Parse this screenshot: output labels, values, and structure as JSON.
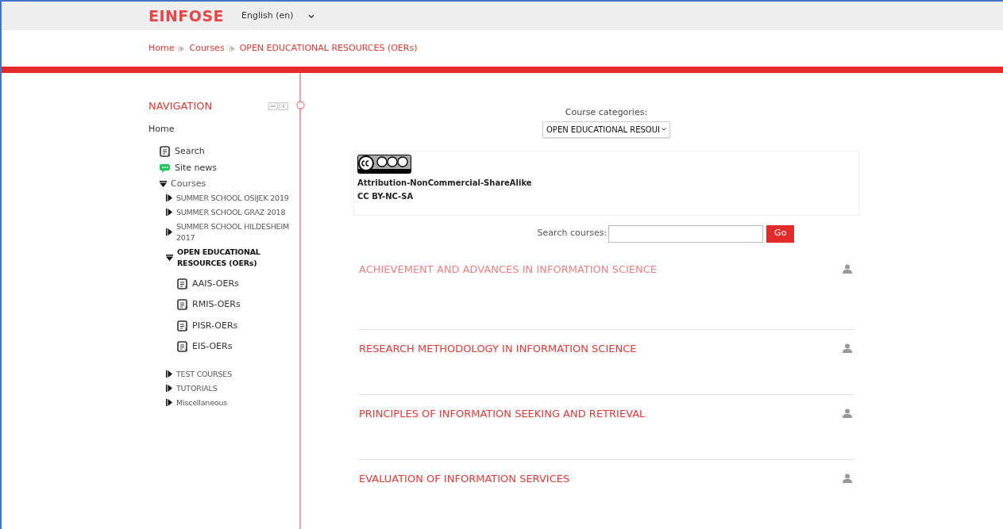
{
  "header": {
    "logo": "EINFOSE",
    "language": "English (en)"
  },
  "breadcrumb": [
    "Home",
    "Courses",
    "OPEN EDUCATIONAL RESOURCES (OERs)"
  ],
  "navigation": {
    "title": "NAVIGATION",
    "items": [
      {
        "label": "Home",
        "children": [
          {
            "label": "Search",
            "kind": "page"
          },
          {
            "label": "Site news",
            "kind": "forum"
          },
          {
            "label": "Courses",
            "kind": "category",
            "expanded": true,
            "selected": false,
            "children": [
              {
                "label": "SUMMER SCHOOL OSIJEK 2019",
                "kind": "category",
                "expanded": false,
                "selected": false
              },
              {
                "label": "SUMMER SCHOOL GRAZ 2018",
                "kind": "category",
                "expanded": false,
                "selected": false
              },
              {
                "label": "SUMMER SCHOOL HILDESHEIM 2017",
                "kind": "category",
                "expanded": false,
                "selected": false
              },
              {
                "label": "OPEN EDUCATIONAL RESOURCES (OERs)",
                "kind": "category",
                "expanded": true,
                "selected": true,
                "children": [
                  {
                    "label": "AAIS-OERs",
                    "kind": "page"
                  },
                  {
                    "label": "RMIS-OERs",
                    "kind": "page"
                  },
                  {
                    "label": "PISR-OERs",
                    "kind": "page"
                  },
                  {
                    "label": "EIS-OERs",
                    "kind": "page"
                  }
                ]
              },
              {
                "label": "TEST COURSES",
                "kind": "category",
                "expanded": false,
                "selected": false
              },
              {
                "label": "TUTORIALS",
                "kind": "category",
                "expanded": false,
                "selected": false
              },
              {
                "label": "Miscellaneous",
                "kind": "category",
                "expanded": false,
                "selected": false
              }
            ]
          }
        ]
      }
    ]
  },
  "categories": {
    "label": "Course categories:",
    "value": "OPEN EDUCATIONAL RESOUI"
  },
  "license": {
    "name": "Attribution-NonCommercial-ShareAlike",
    "code": "CC BY-NC-SA"
  },
  "search": {
    "label": "Search courses:",
    "button": "Go"
  },
  "courses": [
    {
      "title": "ACHIEVEMENT AND ADVANCES IN INFORMATION SCIENCE",
      "hovered": true
    },
    {
      "title": "RESEARCH METHODOLOGY IN INFORMATION SCIENCE",
      "hovered": false
    },
    {
      "title": "PRINCIPLES OF INFORMATION SEEKING AND RETRIEVAL",
      "hovered": false
    },
    {
      "title": "EVALUATION OF INFORMATION SERVICES",
      "hovered": false
    }
  ]
}
